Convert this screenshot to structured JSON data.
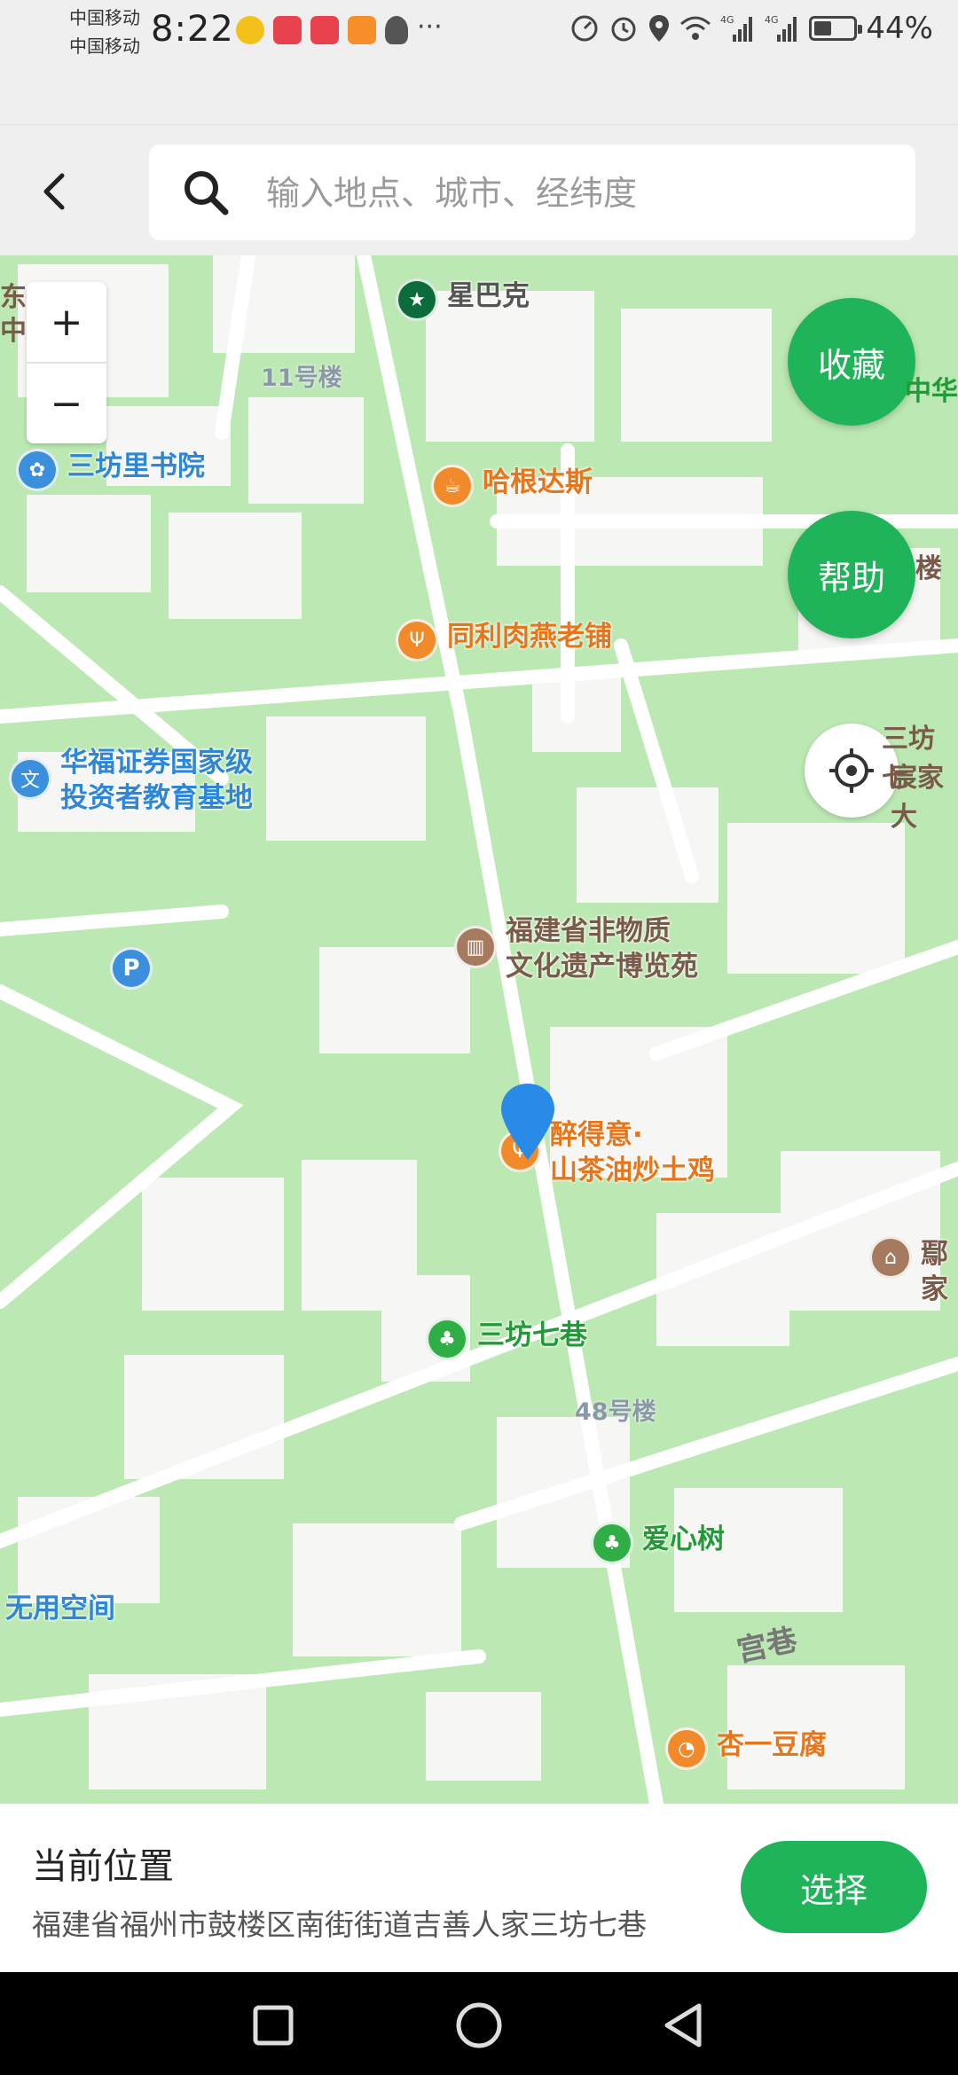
{
  "status_bar": {
    "carrier1": "中国移动",
    "carrier2": "中国移动",
    "time": "8:22",
    "battery_text": "44%",
    "battery_level": 0.44,
    "network1": "4G",
    "network2": "4G",
    "icons": [
      "app-icon",
      "huawei-icon",
      "huawei-icon",
      "video-icon",
      "qq-icon",
      "more-icon",
      "speed-icon",
      "alarm-icon",
      "location-icon",
      "wifi-icon",
      "signal-icon",
      "signal-icon",
      "battery-icon"
    ]
  },
  "header": {
    "search_placeholder": "输入地点、城市、经纬度"
  },
  "map": {
    "zoom_in": "+",
    "zoom_out": "−",
    "favorite_label": "收藏",
    "help_label": "帮助",
    "pois": [
      {
        "id": "starbucks",
        "label": "星巴克"
      },
      {
        "id": "sanfangli",
        "label": "三坊里书院"
      },
      {
        "id": "haagen",
        "label": "哈根达斯"
      },
      {
        "id": "tongli",
        "label": "同利肉燕老铺"
      },
      {
        "id": "huafu",
        "label": "华福证券国家级\n投资者教育基地"
      },
      {
        "id": "heritage",
        "label": "福建省非物质\n文化遗产博览苑"
      },
      {
        "id": "zuideyi",
        "label": "醉得意·\n山茶油炒土鸡"
      },
      {
        "id": "sanfangqixiang",
        "label": "三坊七巷"
      },
      {
        "id": "aixinshu",
        "label": "爱心树"
      },
      {
        "id": "xingyi",
        "label": "杏一豆腐"
      },
      {
        "id": "wuyong",
        "label": "无用空间"
      }
    ],
    "buildings": [
      "11号楼",
      "48号楼"
    ],
    "road_label": "宫巷",
    "edge_labels": [
      "东",
      "中",
      "中华",
      "楼",
      "三坊七",
      "宸家大",
      "鄢家"
    ]
  },
  "bottom": {
    "title": "当前位置",
    "address": "福建省福州市鼓楼区南街街道吉善人家三坊七巷",
    "select_label": "选择"
  },
  "colors": {
    "accent": "#1fb45a",
    "map_green": "#bce8b3",
    "poi_orange": "#f08a2a",
    "poi_blue": "#3b8fdc",
    "marker_blue": "#2a8ae8"
  }
}
